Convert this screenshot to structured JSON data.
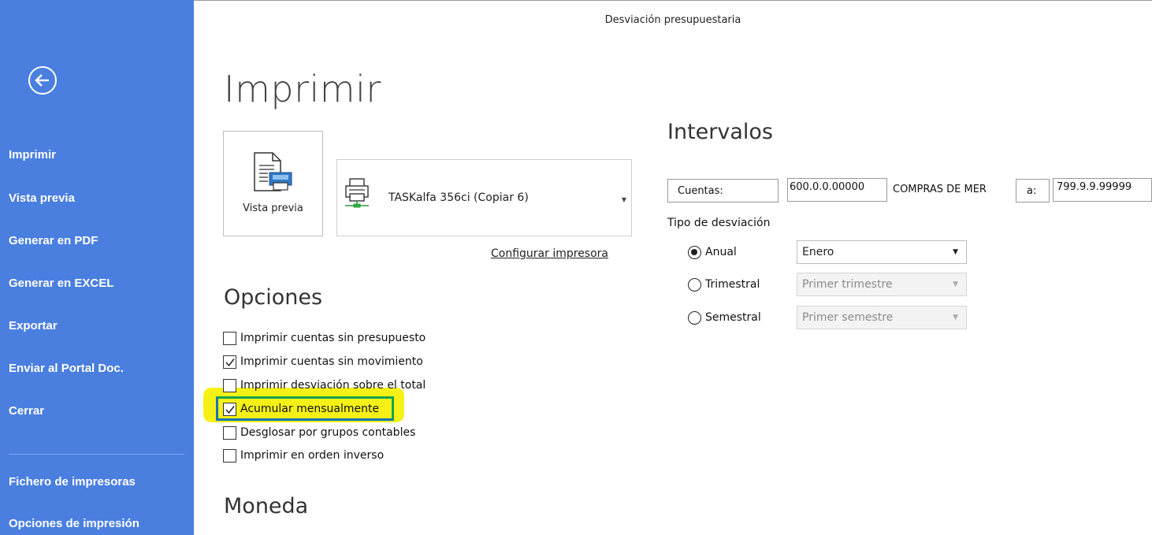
{
  "window": {
    "title": "Desviación presupuestaria"
  },
  "sidebar": {
    "items": [
      {
        "label": "Imprimir"
      },
      {
        "label": "Vista previa"
      },
      {
        "label": "Generar en PDF"
      },
      {
        "label": "Generar en EXCEL"
      },
      {
        "label": "Exportar"
      },
      {
        "label": "Enviar al Portal Doc."
      },
      {
        "label": "Cerrar"
      },
      {
        "label": "Fichero de impresoras"
      },
      {
        "label": "Opciones de impresión"
      }
    ],
    "back_icon": "back-arrow-icon",
    "background": "#4a7fe0"
  },
  "main": {
    "title": "Imprimir",
    "preview_button": {
      "label": "Vista previa",
      "icon": "document-preview-icon"
    },
    "printer": {
      "name": "TASKalfa 356ci (Copiar 6)",
      "icon": "printer-icon"
    },
    "configure_link": "Configurar impresora",
    "options": {
      "heading": "Opciones",
      "items": [
        {
          "label": "Imprimir cuentas sin presupuesto",
          "checked": false
        },
        {
          "label": "Imprimir cuentas sin movimiento",
          "checked": true
        },
        {
          "label": "Imprimir desviación sobre el total",
          "checked": false
        },
        {
          "label": "Acumular mensualmente",
          "checked": true
        },
        {
          "label": "Desglosar por grupos contables",
          "checked": false
        },
        {
          "label": "Imprimir en orden inverso",
          "checked": false
        }
      ]
    },
    "currency": {
      "heading": "Moneda"
    }
  },
  "intervals": {
    "heading": "Intervalos",
    "accounts_label": "Cuentas:",
    "from_value": "600.0.0.00000",
    "from_description": "COMPRAS DE MER",
    "to_label": "a:",
    "to_value": "799.9.9.99999",
    "deviation_type_label": "Tipo de desviación",
    "deviation_types": [
      {
        "label": "Anual",
        "selected": true,
        "select_value": "Enero",
        "enabled": true
      },
      {
        "label": "Trimestral",
        "selected": false,
        "select_value": "Primer trimestre",
        "enabled": false
      },
      {
        "label": "Semestral",
        "selected": false,
        "select_value": "Primer semestre",
        "enabled": false
      }
    ]
  }
}
